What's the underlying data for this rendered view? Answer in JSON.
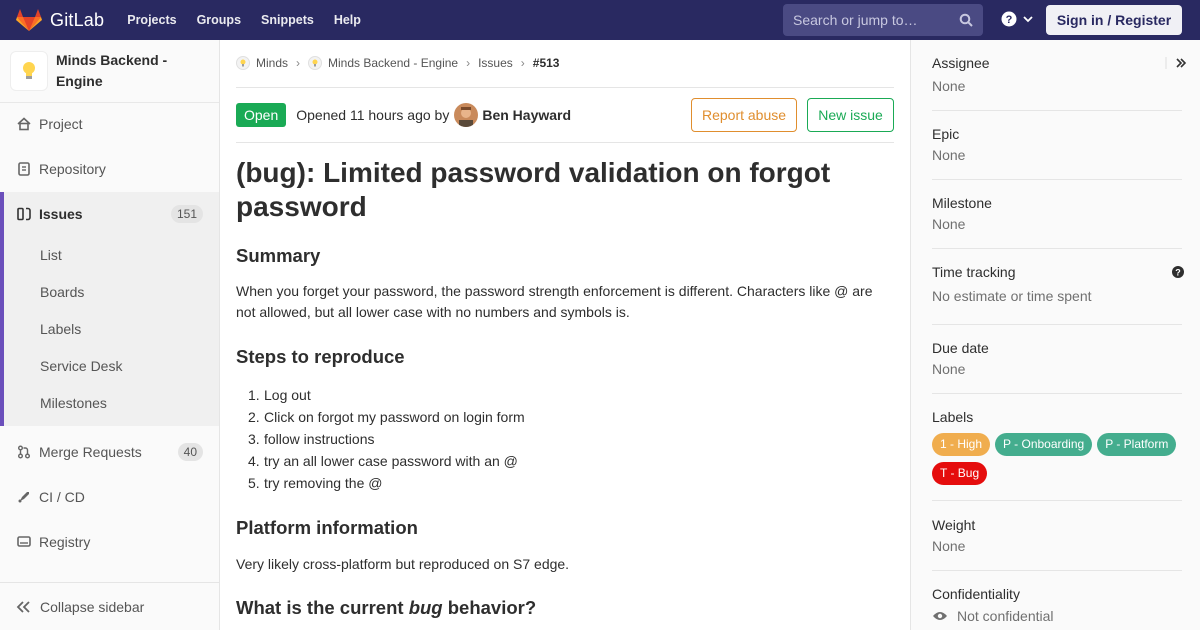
{
  "navbar": {
    "brand": "GitLab",
    "links": [
      "Projects",
      "Groups",
      "Snippets",
      "Help"
    ],
    "search_placeholder": "Search or jump to…",
    "signin": "Sign in / Register",
    "bg_color": "#292961"
  },
  "sidebar": {
    "project_name": "Minds Backend - Engine",
    "items": [
      {
        "label": "Project",
        "icon": "home-icon"
      },
      {
        "label": "Repository",
        "icon": "doc-icon"
      },
      {
        "label": "Issues",
        "icon": "issues-icon",
        "count": "151",
        "active": true
      },
      {
        "label": "Merge Requests",
        "icon": "merge-icon",
        "count": "40"
      },
      {
        "label": "CI / CD",
        "icon": "rocket-icon"
      },
      {
        "label": "Registry",
        "icon": "disk-icon"
      }
    ],
    "sub_items": [
      "List",
      "Boards",
      "Labels",
      "Service Desk",
      "Milestones"
    ],
    "collapse": "Collapse sidebar",
    "accent_color": "#6b4fbb"
  },
  "breadcrumb": [
    "Minds",
    "Minds Backend - Engine",
    "Issues",
    "#513"
  ],
  "issue": {
    "status": "Open",
    "opened_prefix": "Opened 11 hours ago by",
    "author": "Ben Hayward",
    "report_abuse": "Report abuse",
    "new_issue": "New issue",
    "title": "(bug): Limited password validation on forgot password",
    "summary_heading": "Summary",
    "summary_text": "When you forget your password, the password strength enforcement is different. Characters like @ are not allowed, but all lower case with no numbers and symbols is.",
    "steps_heading": "Steps to reproduce",
    "steps": [
      "Log out",
      "Click on forgot my password on login form",
      "follow instructions",
      "try an all lower case password with an @",
      "try removing the @"
    ],
    "platform_heading": "Platform information",
    "platform_text": "Very likely cross-platform but reproduced on S7 edge.",
    "current_heading_a": "What is the current ",
    "current_heading_em": "bug",
    "current_heading_b": " behavior?"
  },
  "right_sidebar": {
    "assignee_label": "Assignee",
    "assignee_value": "None",
    "epic_label": "Epic",
    "epic_value": "None",
    "milestone_label": "Milestone",
    "milestone_value": "None",
    "time_label": "Time tracking",
    "time_value": "No estimate or time spent",
    "due_label": "Due date",
    "due_value": "None",
    "labels_label": "Labels",
    "labels": [
      {
        "text": "1 - High",
        "color": "#f0ad4e"
      },
      {
        "text": "P - Onboarding",
        "color": "#44ad8e"
      },
      {
        "text": "P - Platform",
        "color": "#44ad8e"
      },
      {
        "text": "T - Bug",
        "color": "#e50d0d"
      }
    ],
    "weight_label": "Weight",
    "weight_value": "None",
    "conf_label": "Confidentiality",
    "conf_value": "Not confidential"
  }
}
